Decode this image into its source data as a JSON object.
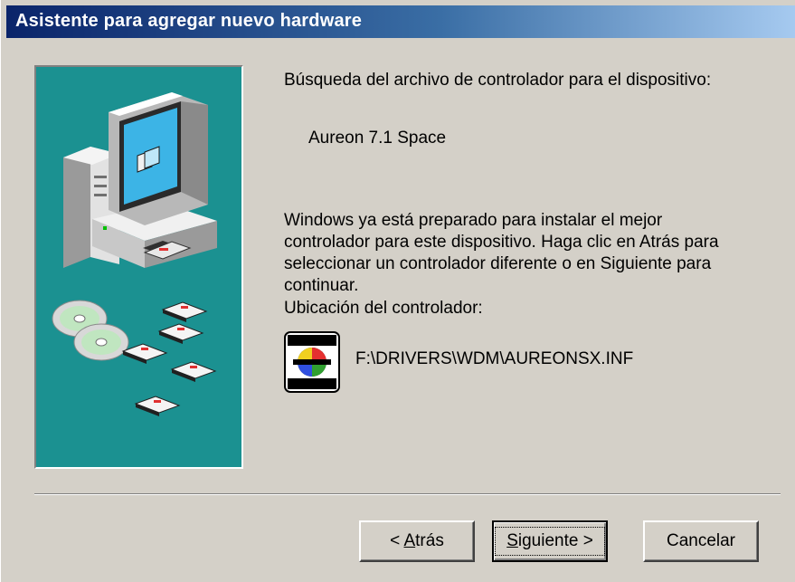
{
  "window": {
    "title": "Asistente para agregar nuevo hardware"
  },
  "content": {
    "heading": "Búsqueda del archivo de controlador para el dispositivo:",
    "device_name": "Aureon 7.1 Space",
    "description_lines": [
      "Windows ya está preparado para instalar el mejor",
      "controlador para este dispositivo. Haga clic en Atrás para",
      "seleccionar un controlador diferente o en Siguiente para",
      "continuar."
    ],
    "location_label": "Ubicación del controlador:",
    "driver_path": "F:\\DRIVERS\\WDM\\AUREONSX.INF",
    "driver_icon": {
      "top_text": "TERRATEC",
      "bottom_text": "PROMEDIA"
    }
  },
  "buttons": {
    "back": {
      "prefix": "< ",
      "mnemonic": "A",
      "rest": "trás"
    },
    "next": {
      "mnemonic": "S",
      "rest": "iguiente >"
    },
    "cancel": {
      "label": "Cancelar"
    }
  },
  "colors": {
    "titlebar_start": "#0a246a",
    "titlebar_end": "#a6caf0",
    "dialog_face": "#d4d0c8",
    "banner_teal": "#1b9191"
  }
}
